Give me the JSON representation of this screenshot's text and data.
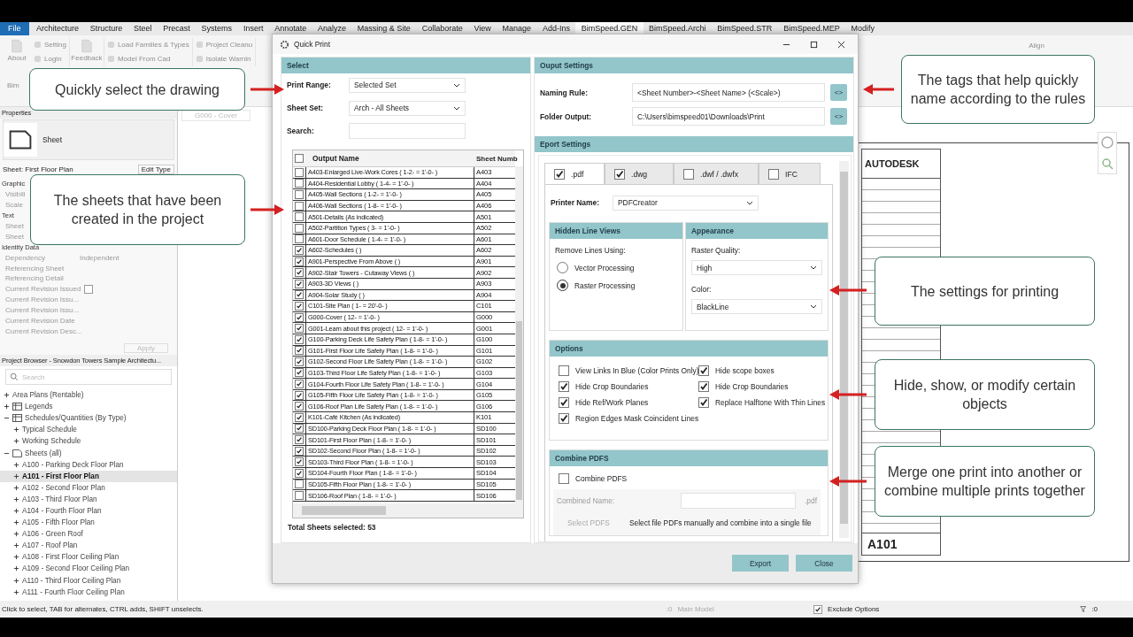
{
  "menu": {
    "file_button": "File",
    "tabs": [
      {
        "label": "Architecture",
        "selected": false
      },
      {
        "label": "Structure",
        "selected": false
      },
      {
        "label": "Steel",
        "selected": false
      },
      {
        "label": "Precast",
        "selected": false
      },
      {
        "label": "Systems",
        "selected": false
      },
      {
        "label": "Insert",
        "selected": false
      },
      {
        "label": "Annotate",
        "selected": false
      },
      {
        "label": "Analyze",
        "selected": false
      },
      {
        "label": "Massing & Site",
        "selected": false
      },
      {
        "label": "Collaborate",
        "selected": false
      },
      {
        "label": "View",
        "selected": false
      },
      {
        "label": "Manage",
        "selected": false
      },
      {
        "label": "Add-Ins",
        "selected": false
      },
      {
        "label": "BimSpeed.GEN",
        "selected": true
      },
      {
        "label": "BimSpeed.Archi",
        "selected": false
      },
      {
        "label": "BimSpeed.STR",
        "selected": false
      },
      {
        "label": "BimSpeed.MEP",
        "selected": false
      },
      {
        "label": "Modify",
        "selected": false
      }
    ]
  },
  "ribbon": {
    "groups": [
      {
        "large": "About",
        "small": [
          "Setting",
          "Login"
        ]
      },
      {
        "large": "Feedback"
      },
      {
        "small": [
          "Load Families & Types",
          "Model From Cad"
        ]
      },
      {
        "small": [
          "Project Cleanu",
          "Isolate Warnin"
        ]
      }
    ],
    "panel_label": "Bim",
    "align": "Align"
  },
  "properties": {
    "title": "Properties",
    "type_name": "Sheet",
    "instance": "Sheet: First Floor Plan",
    "edit_type": "Edit Type",
    "rows": [
      {
        "kind": "group",
        "label": "Graphic"
      },
      {
        "kind": "prop",
        "label": "Visibili"
      },
      {
        "kind": "prop",
        "label": "Scale"
      },
      {
        "kind": "group",
        "label": "Text"
      },
      {
        "kind": "prop",
        "label": "Sheet"
      },
      {
        "kind": "prop",
        "label": "Sheet"
      },
      {
        "kind": "group",
        "label": "Identity Data"
      },
      {
        "kind": "prop",
        "label": "Dependency",
        "value": "Independent"
      },
      {
        "kind": "prop",
        "label": "Referencing Sheet"
      },
      {
        "kind": "prop",
        "label": "Referencing Detail"
      },
      {
        "kind": "check",
        "label": "Current Revision Issued",
        "checked": false
      },
      {
        "kind": "prop",
        "label": "Current Revision Issu..."
      },
      {
        "kind": "prop",
        "label": "Current Revision Issu..."
      },
      {
        "kind": "prop",
        "label": "Current Revision Date"
      },
      {
        "kind": "prop",
        "label": "Current Revision Desc..."
      }
    ],
    "apply": "Apply"
  },
  "project_browser": {
    "title": "Project Browser - Snowdon Towers Sample Architectu...",
    "search": {
      "placeholder": "Search"
    },
    "tree": [
      {
        "label": "Area Plans (Rentable)",
        "expanded": false,
        "selected": false
      },
      {
        "label": "Legends",
        "kind": "legend",
        "expanded": false,
        "selected": false
      },
      {
        "label": "Schedules/Quantities (By Type)",
        "kind": "schedule",
        "expanded": true,
        "selected": false,
        "children": [
          {
            "label": "Typical Schedule",
            "expanded": false,
            "selected": false
          },
          {
            "label": "Working Schedule",
            "expanded": false,
            "selected": false
          }
        ]
      },
      {
        "label": "Sheets (all)",
        "kind": "sheets",
        "expanded": true,
        "selected": false,
        "children": [
          {
            "label": "A100 - Parking Deck Floor Plan",
            "expanded": false,
            "selected": false
          },
          {
            "label": "A101 - First Floor Plan",
            "expanded": false,
            "selected": true
          },
          {
            "label": "A102 - Second Floor Plan",
            "expanded": false,
            "selected": false
          },
          {
            "label": "A103 - Third Floor Plan",
            "expanded": false,
            "selected": false
          },
          {
            "label": "A104 - Fourth Floor Plan",
            "expanded": false,
            "selected": false
          },
          {
            "label": "A105 - Fifth Floor Plan",
            "expanded": false,
            "selected": false
          },
          {
            "label": "A106 - Green Roof",
            "expanded": false,
            "selected": false
          },
          {
            "label": "A107 - Roof Plan",
            "expanded": false,
            "selected": false
          },
          {
            "label": "A108 - First Floor Ceiling Plan",
            "expanded": false,
            "selected": false
          },
          {
            "label": "A109 - Second Floor Ceiling Plan",
            "expanded": false,
            "selected": false
          },
          {
            "label": "A110 - Third Floor Ceiling Plan",
            "expanded": false,
            "selected": false
          },
          {
            "label": "A111 - Fourth Floor Ceiling Plan",
            "expanded": false,
            "selected": false
          }
        ]
      }
    ]
  },
  "view": {
    "tab": "G000 - Cover",
    "sheet_drawing": {
      "logo": "AUTODESK",
      "sheet_number": "A101"
    }
  },
  "dialog": {
    "title": "Quick Print",
    "select": {
      "header": "Select",
      "print_range": {
        "label": "Print Range:",
        "value": "Selected Set"
      },
      "sheet_set": {
        "label": "Sheet Set:",
        "value": "Arch - All Sheets"
      },
      "search": {
        "label": "Search:"
      },
      "table": {
        "columns": [
          "Output Name",
          "Sheet Numb"
        ],
        "all_checked": false,
        "rows": [
          {
            "name": "A403-Enlarged Live-Work Cores ( 1-2- = 1'-0- )",
            "number": "A403",
            "checked": false
          },
          {
            "name": "A404-Residential Lobby ( 1-4- = 1'-0- )",
            "number": "A404",
            "checked": false
          },
          {
            "name": "A405-Wall Sections ( 1-2- = 1'-0- )",
            "number": "A405",
            "checked": false
          },
          {
            "name": "A406-Wall Sections ( 1-8- = 1'-0- )",
            "number": "A406",
            "checked": false
          },
          {
            "name": "A501-Details (As indicated)",
            "number": "A501",
            "checked": false
          },
          {
            "name": "A502-Partition Types ( 3- = 1'-0- )",
            "number": "A502",
            "checked": false
          },
          {
            "name": "A601-Door Schedule ( 1-4- = 1'-0- )",
            "number": "A601",
            "checked": false
          },
          {
            "name": "A602-Schedules ( )",
            "number": "A602",
            "checked": true
          },
          {
            "name": "A901-Perspective From Above ( )",
            "number": "A901",
            "checked": true
          },
          {
            "name": "A902-Stair Towers - Cutaway Views ( )",
            "number": "A902",
            "checked": true
          },
          {
            "name": "A903-3D Views ( )",
            "number": "A903",
            "checked": true
          },
          {
            "name": "A904-Solar Study ( )",
            "number": "A904",
            "checked": true
          },
          {
            "name": "C101-Site Plan ( 1- = 20'-0- )",
            "number": "C101",
            "checked": true
          },
          {
            "name": "G000-Cover ( 12- = 1'-0- )",
            "number": "G000",
            "checked": true
          },
          {
            "name": "G001-Learn about this project ( 12- = 1'-0- )",
            "number": "G001",
            "checked": true
          },
          {
            "name": "G100-Parking Deck Life Safety Plan ( 1-8- = 1'-0- )",
            "number": "G100",
            "checked": true
          },
          {
            "name": "G101-First Floor Life Safety Plan ( 1-8- = 1'-0- )",
            "number": "G101",
            "checked": true
          },
          {
            "name": "G102-Second Floor Life Safety Plan ( 1-8- = 1'-0- )",
            "number": "G102",
            "checked": true
          },
          {
            "name": "G103-Third Floor Life Safety Plan ( 1-8- = 1'-0- )",
            "number": "G103",
            "checked": true
          },
          {
            "name": "G104-Fourth Floor Life Safety Plan ( 1-8- = 1'-0- )",
            "number": "G104",
            "checked": true
          },
          {
            "name": "G105-Fifth Floor Life Safety Plan ( 1-8- = 1'-0- )",
            "number": "G105",
            "checked": true
          },
          {
            "name": "G106-Roof Plan Life Safety Plan ( 1-8- = 1'-0- )",
            "number": "G106",
            "checked": true
          },
          {
            "name": "K101-Café Kitchen (As indicated)",
            "number": "K101",
            "checked": true
          },
          {
            "name": "SD100-Parking Deck Floor Plan ( 1-8- = 1'-0- )",
            "number": "SD100",
            "checked": true
          },
          {
            "name": "SD101-First Floor Plan ( 1-8- = 1'-0- )",
            "number": "SD101",
            "checked": true
          },
          {
            "name": "SD102-Second Floor Plan ( 1-8- = 1'-0- )",
            "number": "SD102",
            "checked": true
          },
          {
            "name": "SD103-Third Floor Plan ( 1-8- = 1'-0- )",
            "number": "SD103",
            "checked": true
          },
          {
            "name": "SD104-Fourth Floor Plan ( 1-8- = 1'-0- )",
            "number": "SD104",
            "checked": true
          },
          {
            "name": "SD105-Fifth Floor Plan ( 1-8- = 1'-0- )",
            "number": "SD105",
            "checked": false
          },
          {
            "name": "SD106-Roof Plan ( 1-8- = 1'-0- )",
            "number": "SD106",
            "checked": false
          }
        ]
      },
      "total": "Total Sheets selected: 53"
    },
    "output": {
      "header": "Ouput Settings",
      "naming_rule": {
        "label": "Naming Rule:",
        "value": "<Sheet Number>-<Sheet Name> (<Scale>)",
        "tag_button": "<>"
      },
      "folder_output": {
        "label": "Folder Output:",
        "value": "C:\\Users\\bimspeed01\\Downloads\\Print",
        "tag_button": "<>"
      }
    },
    "export": {
      "header": "Eport Settings",
      "tabs": [
        {
          "label": ".pdf",
          "checked": true,
          "selected": true
        },
        {
          "label": ".dwg",
          "checked": true,
          "selected": false
        },
        {
          "label": ".dwf / .dwfx",
          "checked": false,
          "selected": false
        },
        {
          "label": "IFC",
          "checked": false,
          "selected": false
        }
      ],
      "printer": {
        "label": "Printer Name:",
        "value": "PDFCreator"
      },
      "hidden_line": {
        "header": "Hidden Line Views",
        "label": "Remove Lines Using:",
        "options": [
          {
            "label": "Vector Processing",
            "selected": false
          },
          {
            "label": "Raster Processing",
            "selected": true
          }
        ]
      },
      "appearance": {
        "header": "Appearance",
        "raster_quality": {
          "label": "Raster Quality:",
          "value": "High"
        },
        "color": {
          "label": "Color:",
          "value": "BlackLine"
        }
      },
      "options": {
        "header": "Options",
        "items": [
          {
            "label": "View Links In Blue (Color Prints Only)",
            "checked": false
          },
          {
            "label": "Hide scope boxes",
            "checked": true
          },
          {
            "label": "Hide Crop Boundaries",
            "checked": true
          },
          {
            "label": "Hide Crop Boundaries",
            "checked": true
          },
          {
            "label": "Hide Ref/Work Planes",
            "checked": true
          },
          {
            "label": "Replace Halftone With Thin Lines",
            "checked": true
          },
          {
            "label": "Region Edges Mask Coincident Lines",
            "checked": true
          }
        ]
      },
      "combine": {
        "header": "Combine PDFS",
        "checkbox": {
          "label": "Combine PDFS",
          "checked": false
        },
        "name_label": "Combined Name:",
        "extension": ".pdf",
        "select_button": "Select PDFS",
        "hint": "Select file PDFs manually and combine into a single file"
      }
    },
    "buttons": [
      "Export",
      "Close"
    ]
  },
  "callouts": [
    "Quickly select the drawing",
    "The sheets that have been created in the project",
    "The tags that help quickly name according to the rules",
    "The settings for printing",
    "Hide, show, or modify certain objects",
    "Merge one print into another or combine multiple prints together"
  ],
  "status_bar": {
    "hint": "Click to select, TAB for alternates, CTRL adds, SHIFT unselects.",
    "workset": ":0",
    "model": "Main Model",
    "exclude_options": {
      "label": "Exclude Options",
      "checked": true
    },
    "filter_count": ":0"
  }
}
